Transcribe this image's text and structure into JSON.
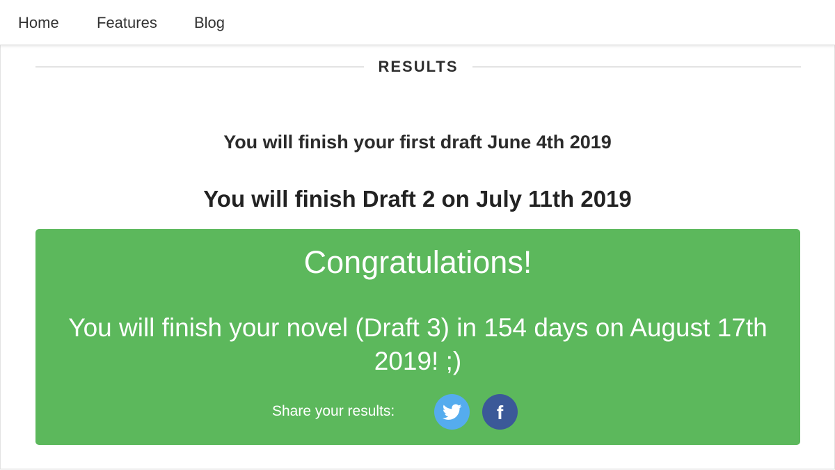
{
  "nav": {
    "items": [
      {
        "label": "Home"
      },
      {
        "label": "Features"
      },
      {
        "label": "Blog"
      }
    ]
  },
  "results": {
    "section_title": "RESULTS",
    "first_draft_line": "You will finish your first draft June 4th 2019",
    "draft2_line": "You will finish Draft 2 on July 11th 2019",
    "congrats": {
      "title": "Congratulations!",
      "message": "You will finish your novel (Draft 3) in 154 days on August 17th 2019! ;)",
      "share_label": "Share your results:",
      "share_buttons": [
        {
          "icon": "twitter-icon",
          "color": "#55acee"
        },
        {
          "icon": "facebook-icon",
          "glyph": "f",
          "color": "#3b5998"
        }
      ],
      "background_color": "#5cb85c"
    }
  }
}
